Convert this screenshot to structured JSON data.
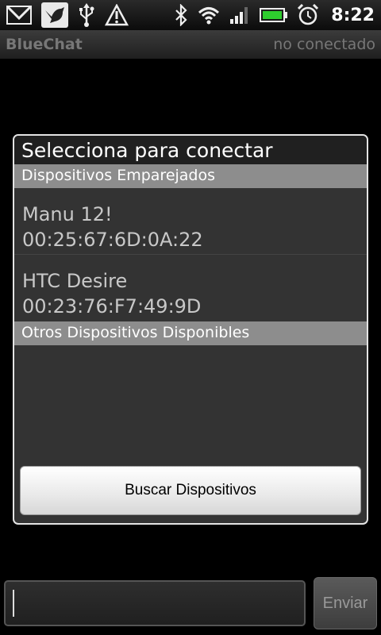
{
  "status_bar": {
    "time": "8:22",
    "icons": [
      "gmail-icon",
      "bird-notification-icon",
      "usb-icon",
      "warning-icon",
      "bluetooth-icon",
      "wifi-icon",
      "signal-icon",
      "battery-icon",
      "alarm-icon"
    ],
    "battery_color": "#2ecc2e"
  },
  "app": {
    "title": "BlueChat",
    "connection_status": "no conectado"
  },
  "dialog": {
    "title": "Selecciona para conectar",
    "paired_header": "Dispositivos Emparejados",
    "paired_devices": [
      {
        "name": "Manu 12!",
        "address": "00:25:67:6D:0A:22"
      },
      {
        "name": "HTC Desire",
        "address": "00:23:76:F7:49:9D"
      }
    ],
    "other_header": "Otros Dispositivos Disponibles",
    "scan_label": "Buscar Dispositivos"
  },
  "composer": {
    "input_value": "",
    "send_label": "Enviar"
  }
}
